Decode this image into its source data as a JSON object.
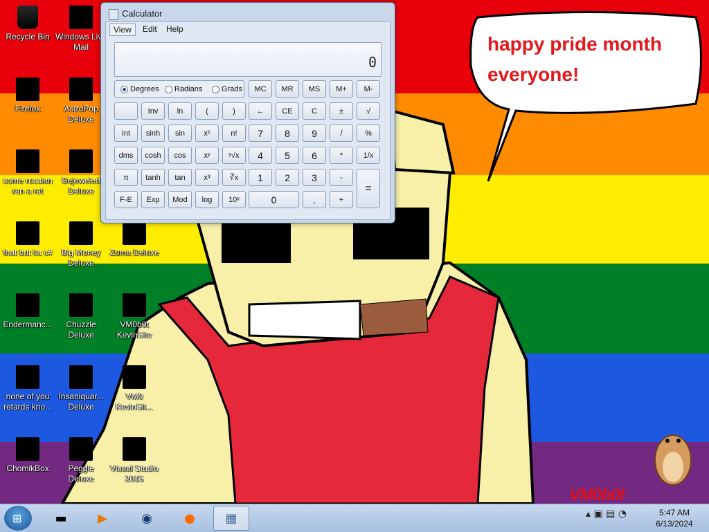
{
  "wallpaper": {
    "bubble_text": "happy pride month everyone!",
    "logo_text": "VM0b0t"
  },
  "desktop_icons": [
    {
      "label": "Recycle Bin"
    },
    {
      "label": "Windows Live\nMail"
    },
    {
      "label": "Firefox"
    },
    {
      "label": "AstroPop\nDeluxe"
    },
    {
      "label": "some russian\nran a rat"
    },
    {
      "label": "Bejeweled\nDeluxe"
    },
    {
      "label": "that but its c#"
    },
    {
      "label": "Big Money\nDeluxe"
    },
    {
      "label": "Zuma Deluxe"
    },
    {
      "label": "Endermanc..."
    },
    {
      "label": "Chuzzle\nDeluxe"
    },
    {
      "label": "VM0b0t\nKevinSite"
    },
    {
      "label": "none of you\nretards kno..."
    },
    {
      "label": "Insaniquar...\nDeluxe"
    },
    {
      "label": "VM0\nKevinSit..."
    },
    {
      "label": "ChomikBox"
    },
    {
      "label": "Peggle Deluxe"
    },
    {
      "label": "Visual Studio\n2015"
    }
  ],
  "calculator": {
    "title": "Calculator",
    "menu": {
      "view": "View",
      "edit": "Edit",
      "help": "Help"
    },
    "display": "0",
    "angle_modes": {
      "degrees": "Degrees",
      "radians": "Radians",
      "grads": "Grads",
      "selected": "Degrees"
    },
    "memory": [
      "MC",
      "MR",
      "MS",
      "M+",
      "M-"
    ],
    "rows": [
      [
        "",
        "Inv",
        "ln",
        "(",
        ")",
        "←",
        "CE",
        "C",
        "±",
        "√"
      ],
      [
        "Int",
        "sinh",
        "sin",
        "x²",
        "n!",
        "7",
        "8",
        "9",
        "/",
        "%"
      ],
      [
        "dms",
        "cosh",
        "cos",
        "xʸ",
        "ʸ√x",
        "4",
        "5",
        "6",
        "*",
        "1/x"
      ],
      [
        "π",
        "tanh",
        "tan",
        "x³",
        "∛x",
        "1",
        "2",
        "3",
        "-",
        "="
      ],
      [
        "F-E",
        "Exp",
        "Mod",
        "log",
        "10ˣ",
        "0",
        ".",
        "+"
      ]
    ]
  },
  "taskbar": {
    "start_glyph": "⊞",
    "apps": [
      {
        "name": "terminal",
        "glyph": "▬"
      },
      {
        "name": "media-player",
        "glyph": "▶"
      },
      {
        "name": "globe",
        "glyph": "◉"
      },
      {
        "name": "firefox",
        "glyph": "●"
      },
      {
        "name": "calculator",
        "glyph": "▦"
      }
    ],
    "tray_glyphs": "▴ ▣ ▤ ◔",
    "clock_time": "5:47 AM",
    "clock_date": "6/13/2024"
  }
}
